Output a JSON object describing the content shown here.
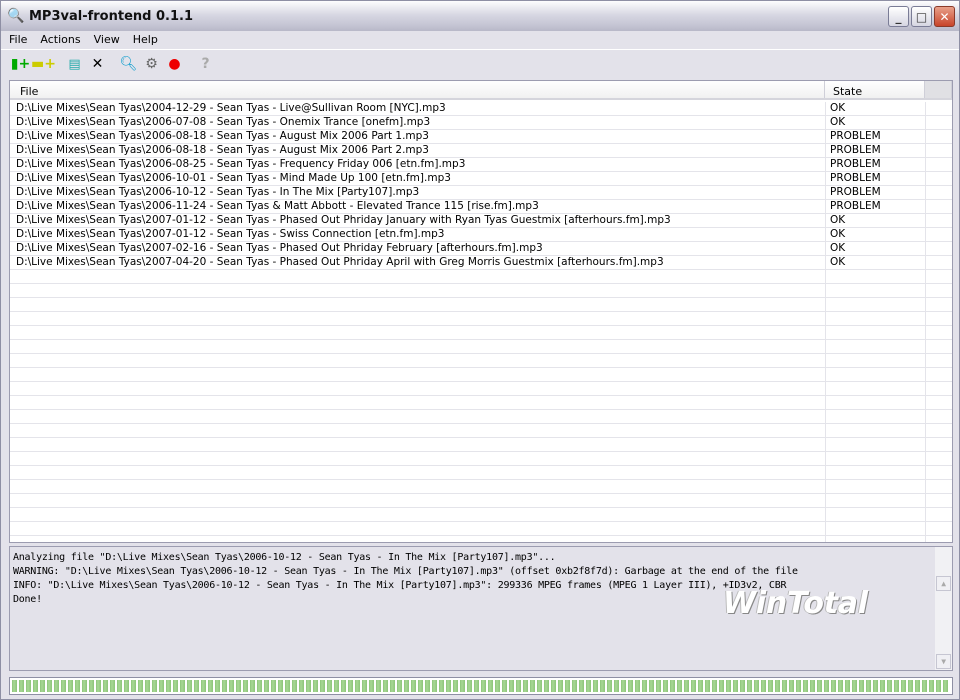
{
  "window": {
    "title": "MP3val-frontend 0.1.1",
    "watermark": "WinTotal"
  },
  "menu": [
    "File",
    "Actions",
    "View",
    "Help"
  ],
  "toolbar": [
    {
      "name": "add-file-icon",
      "glyph": "📄"
    },
    {
      "name": "add-folder-icon",
      "glyph": "📁"
    },
    {
      "name": "remove-icon",
      "glyph": "📋"
    },
    {
      "name": "clear-icon",
      "glyph": "✕"
    },
    {
      "name": "scan-icon",
      "glyph": "🔍"
    },
    {
      "name": "fix-icon",
      "glyph": "⚙"
    },
    {
      "name": "stop-icon",
      "glyph": "●"
    },
    {
      "name": "help-icon",
      "glyph": "?"
    }
  ],
  "list": {
    "headers": {
      "file": "File",
      "state": "State"
    },
    "rows": [
      {
        "file": "D:\\Live Mixes\\Sean Tyas\\2004-12-29 - Sean Tyas - Live@Sullivan Room [NYC].mp3",
        "state": "OK"
      },
      {
        "file": "D:\\Live Mixes\\Sean Tyas\\2006-07-08 - Sean Tyas - Onemix Trance [onefm].mp3",
        "state": "OK"
      },
      {
        "file": "D:\\Live Mixes\\Sean Tyas\\2006-08-18 - Sean Tyas - August Mix 2006 Part 1.mp3",
        "state": "PROBLEM"
      },
      {
        "file": "D:\\Live Mixes\\Sean Tyas\\2006-08-18 - Sean Tyas - August Mix 2006 Part 2.mp3",
        "state": "PROBLEM"
      },
      {
        "file": "D:\\Live Mixes\\Sean Tyas\\2006-08-25 - Sean Tyas - Frequency Friday 006 [etn.fm].mp3",
        "state": "PROBLEM"
      },
      {
        "file": "D:\\Live Mixes\\Sean Tyas\\2006-10-01 - Sean Tyas - Mind Made Up 100 [etn.fm].mp3",
        "state": "PROBLEM"
      },
      {
        "file": "D:\\Live Mixes\\Sean Tyas\\2006-10-12 - Sean Tyas - In The Mix [Party107].mp3",
        "state": "PROBLEM"
      },
      {
        "file": "D:\\Live Mixes\\Sean Tyas\\2006-11-24 - Sean Tyas & Matt Abbott - Elevated Trance 115 [rise.fm].mp3",
        "state": "PROBLEM"
      },
      {
        "file": "D:\\Live Mixes\\Sean Tyas\\2007-01-12 - Sean Tyas - Phased Out Phriday January with Ryan Tyas Guestmix [afterhours.fm].mp3",
        "state": "OK"
      },
      {
        "file": "D:\\Live Mixes\\Sean Tyas\\2007-01-12 - Sean Tyas - Swiss Connection [etn.fm].mp3",
        "state": "OK"
      },
      {
        "file": "D:\\Live Mixes\\Sean Tyas\\2007-02-16 - Sean Tyas - Phased Out Phriday February [afterhours.fm].mp3",
        "state": "OK"
      },
      {
        "file": "D:\\Live Mixes\\Sean Tyas\\2007-04-20 - Sean Tyas - Phased Out Phriday April with Greg Morris Guestmix [afterhours.fm].mp3",
        "state": "OK"
      }
    ]
  },
  "log": [
    "Analyzing file \"D:\\Live Mixes\\Sean Tyas\\2006-10-12 - Sean Tyas - In The Mix [Party107].mp3\"...",
    "WARNING: \"D:\\Live Mixes\\Sean Tyas\\2006-10-12 - Sean Tyas - In The Mix [Party107].mp3\" (offset 0xb2f8f7d): Garbage at the end of the file",
    "INFO: \"D:\\Live Mixes\\Sean Tyas\\2006-10-12 - Sean Tyas - In The Mix [Party107].mp3\": 299336 MPEG frames (MPEG 1 Layer III), +ID3v2, CBR",
    "Done!"
  ],
  "progress": {
    "percent": 100
  }
}
